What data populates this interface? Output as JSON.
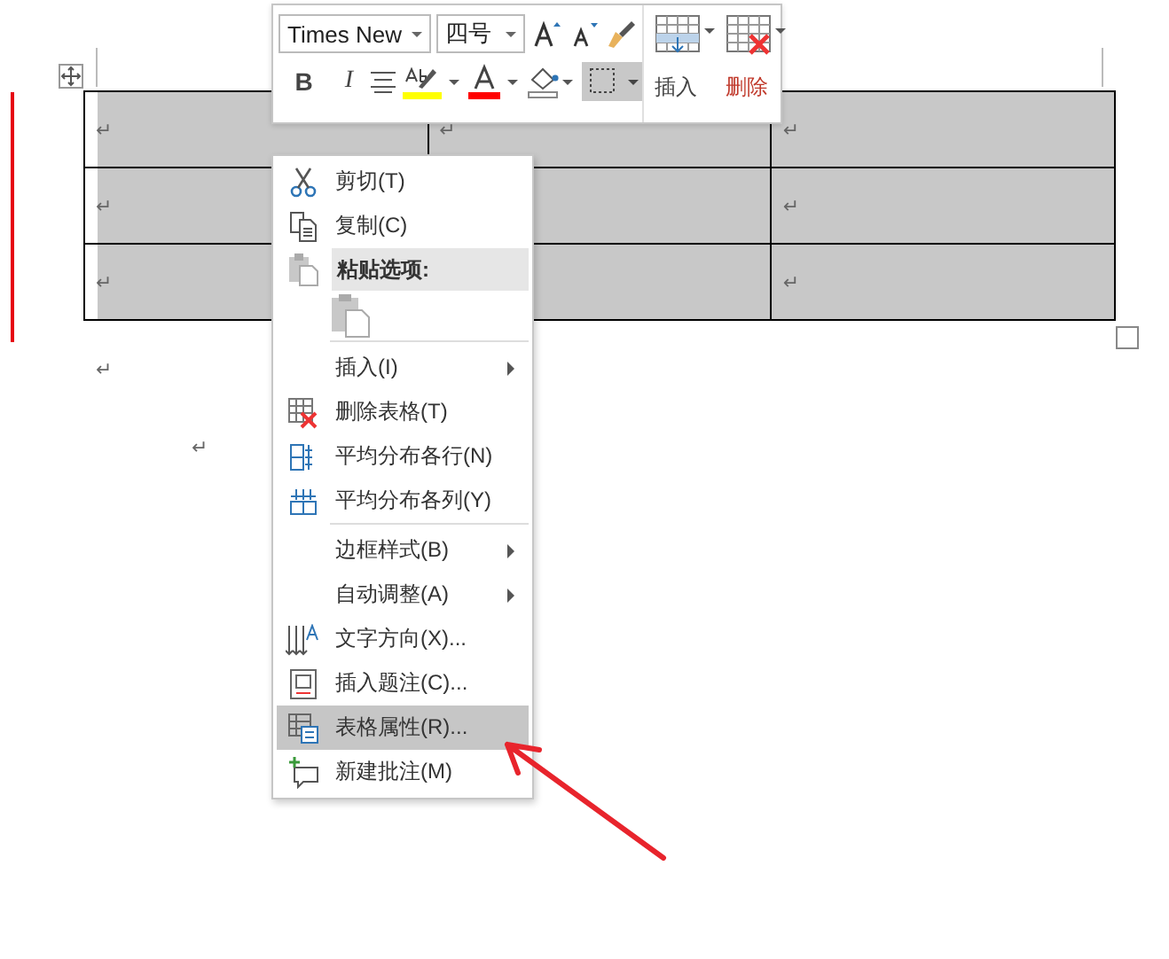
{
  "document": {
    "table": {
      "rows": [
        {
          "cells": [
            {
              "mark": "↵"
            },
            {
              "mark": "↵"
            },
            {
              "mark": "↵"
            }
          ]
        },
        {
          "cells": [
            {
              "mark": "↵"
            },
            {},
            {
              "mark": "↵"
            }
          ]
        },
        {
          "cells": [
            {
              "mark": "↵"
            },
            {},
            {
              "mark": "↵"
            }
          ]
        }
      ]
    },
    "paragraph_marks": [
      "↵",
      "↵"
    ]
  },
  "mini_toolbar": {
    "font": "Times New",
    "size": "四号",
    "bold": "B",
    "italic": "I",
    "buttons": [
      {
        "label": "插入"
      },
      {
        "label": "删除"
      }
    ],
    "border_button": {
      "selected": true
    }
  },
  "context_menu": {
    "items": [
      {
        "kind": "command",
        "label": "剪切(T)",
        "submenu": false,
        "selected": false,
        "separator_before": false
      },
      {
        "kind": "command",
        "label": "复制(C)",
        "submenu": false,
        "selected": false,
        "separator_before": false
      },
      {
        "kind": "heading",
        "label": "粘贴选项:"
      },
      {
        "kind": "paste_options"
      },
      {
        "kind": "command",
        "label": "插入(I)",
        "submenu": true,
        "selected": false,
        "separator_before": true
      },
      {
        "kind": "command",
        "label": "删除表格(T)",
        "submenu": false,
        "selected": false,
        "separator_before": false
      },
      {
        "kind": "command",
        "label": "平均分布各行(N)",
        "submenu": false,
        "selected": false,
        "separator_before": false
      },
      {
        "kind": "command",
        "label": "平均分布各列(Y)",
        "submenu": false,
        "selected": false,
        "separator_before": false
      },
      {
        "kind": "command",
        "label": "边框样式(B)",
        "submenu": true,
        "selected": false,
        "separator_before": true
      },
      {
        "kind": "command",
        "label": "自动调整(A)",
        "submenu": true,
        "selected": false,
        "separator_before": false
      },
      {
        "kind": "command",
        "label": "文字方向(X)...",
        "submenu": false,
        "selected": false,
        "separator_before": false
      },
      {
        "kind": "command",
        "label": "插入题注(C)...",
        "submenu": false,
        "selected": false,
        "separator_before": false
      },
      {
        "kind": "command",
        "label": "表格属性(R)...",
        "submenu": false,
        "selected": true,
        "separator_before": false
      },
      {
        "kind": "command",
        "label": "新建批注(M)",
        "submenu": false,
        "selected": false,
        "separator_before": false
      }
    ]
  }
}
